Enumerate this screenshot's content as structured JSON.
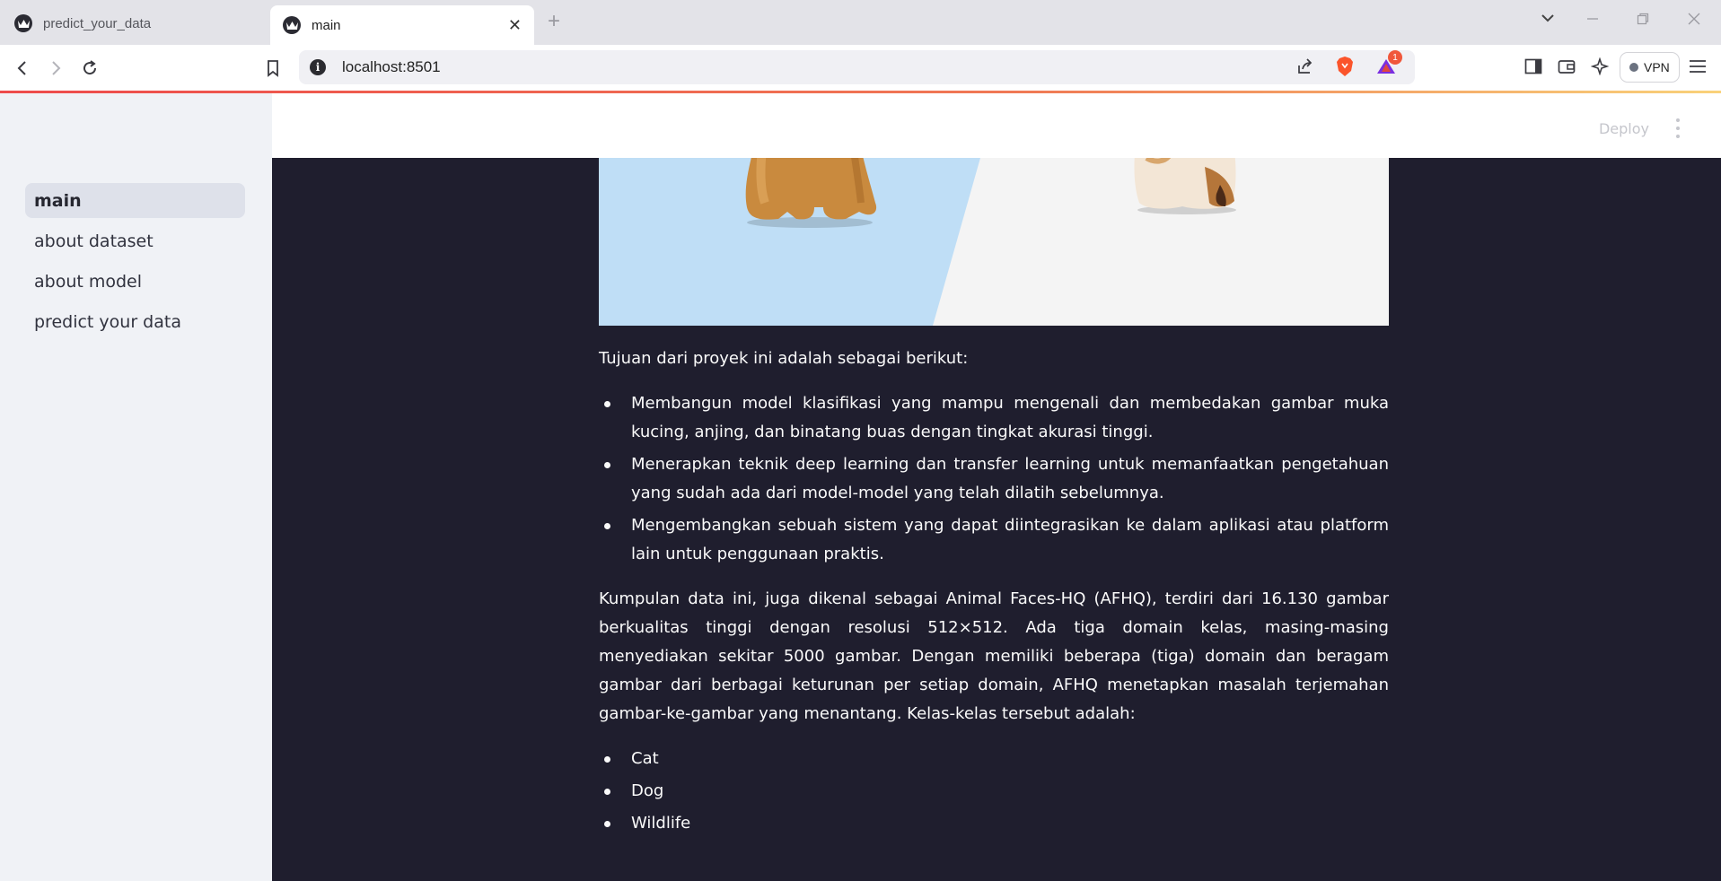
{
  "browser": {
    "tabs": [
      {
        "title": "predict_your_data",
        "active": false
      },
      {
        "title": "main",
        "active": true
      }
    ],
    "url": "localhost:8501",
    "notification_count": "1",
    "vpn_label": "VPN"
  },
  "sidebar": {
    "items": [
      {
        "label": "main",
        "selected": true
      },
      {
        "label": "about dataset",
        "selected": false
      },
      {
        "label": "about model",
        "selected": false
      },
      {
        "label": "predict your data",
        "selected": false
      }
    ]
  },
  "header": {
    "deploy_label": "Deploy"
  },
  "main": {
    "intro": "Tujuan dari proyek ini adalah sebagai berikut:",
    "goals": [
      "Membangun model klasifikasi yang mampu mengenali dan membedakan gambar muka kucing, anjing, dan binatang buas dengan tingkat akurasi tinggi.",
      "Menerapkan teknik deep learning dan transfer learning untuk memanfaatkan pengetahuan yang sudah ada dari model-model yang telah dilatih sebelumnya.",
      "Mengembangkan sebuah sistem yang dapat diintegrasikan ke dalam aplikasi atau platform lain untuk penggunaan praktis."
    ],
    "dataset_paragraph": "Kumpulan data ini, juga dikenal sebagai Animal Faces-HQ (AFHQ), terdiri dari 16.130 gambar berkualitas tinggi dengan resolusi 512×512. Ada tiga domain kelas, masing-masing menyediakan sekitar 5000 gambar. Dengan memiliki beberapa (tiga) domain dan beragam gambar dari berbagai keturunan per setiap domain, AFHQ menetapkan masalah terjemahan gambar-ke-gambar yang menantang. Kelas-kelas tersebut adalah:",
    "classes": [
      "Cat",
      "Dog",
      "Wildlife"
    ]
  },
  "colors": {
    "app_background": "#1f1e2e",
    "sidebar_background": "#f0f2f6",
    "hero_blue": "#bfdef6"
  }
}
